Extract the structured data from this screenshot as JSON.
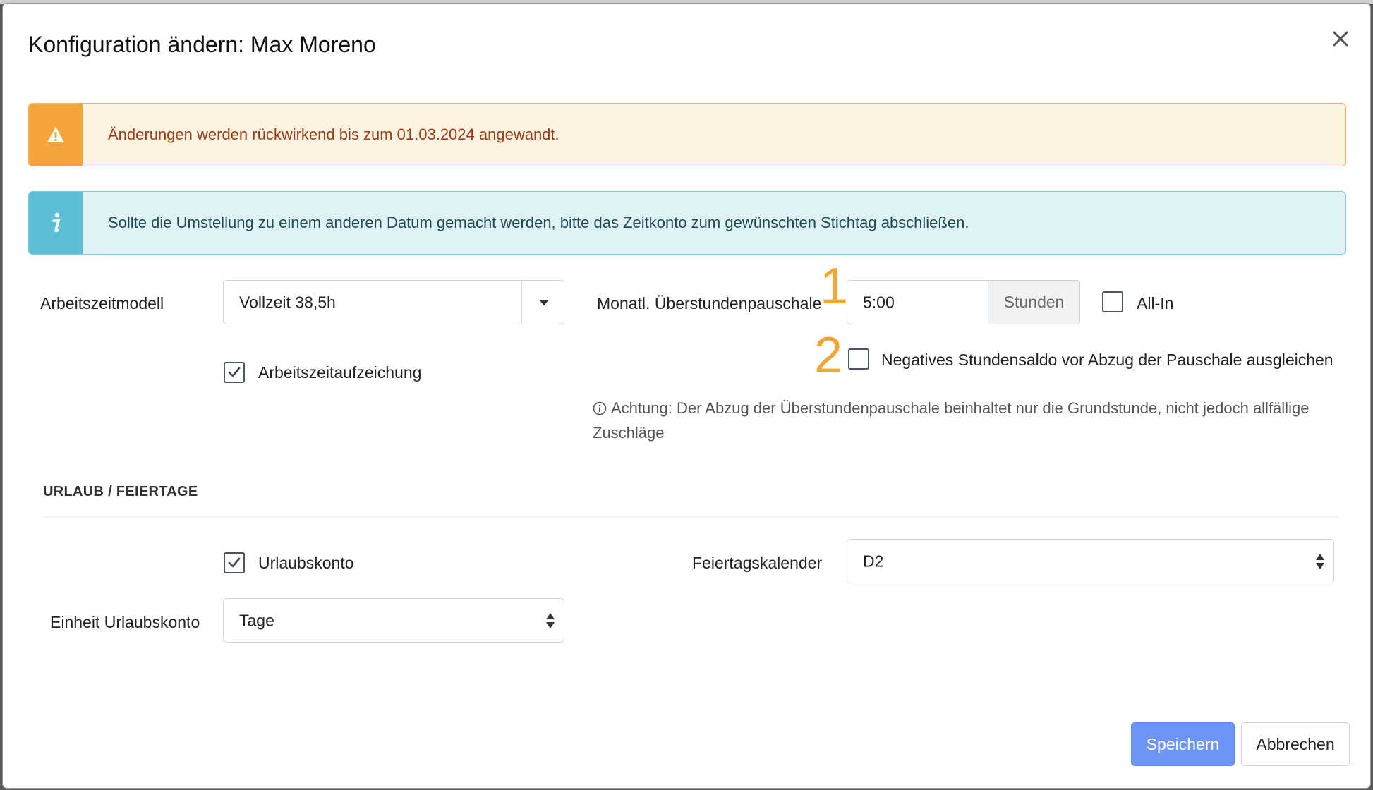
{
  "dialog": {
    "title": "Konfiguration ändern: Max Moreno",
    "close_icon": "close-icon"
  },
  "alerts": {
    "warning": {
      "icon": "warning-icon",
      "text": "Änderungen werden rückwirkend bis zum 01.03.2024 angewandt.",
      "accent": "#f4a43c"
    },
    "info": {
      "icon": "info-icon",
      "text": "Sollte die Umstellung zu einem anderen Datum gemacht werden, bitte das Zeitkonto zum gewünschten Stichtag abschließen.",
      "accent": "#5bbfd6"
    }
  },
  "work": {
    "model_label": "Arbeitszeitmodell",
    "model_value": "Vollzeit 38,5h",
    "recording_label": "Arbeitszeitaufzeichung",
    "recording_checked": true,
    "overtime_label": "Monatl. Überstundenpauschale",
    "overtime_value": "5:00",
    "overtime_unit": "Stunden",
    "allin_label": "All-In",
    "allin_checked": false,
    "negative_label": "Negatives Stundensaldo vor Abzug der Pauschale ausgleichen",
    "negative_checked": false,
    "hint": "Achtung: Der Abzug der Überstundenpauschale beinhaltet nur die Grundstunde, nicht jedoch allfällige Zuschläge"
  },
  "annotations": {
    "one": "1",
    "two": "2",
    "color": "#f3a531"
  },
  "vacation": {
    "section_title": "URLAUB / FEIERTAGE",
    "account_label": "Urlaubskonto",
    "account_checked": true,
    "holiday_label": "Feiertagskalender",
    "holiday_value": "D2",
    "unit_label": "Einheit Urlaubskonto",
    "unit_value": "Tage"
  },
  "buttons": {
    "save": "Speichern",
    "cancel": "Abbrechen",
    "primary_color": "#6e94f7"
  }
}
